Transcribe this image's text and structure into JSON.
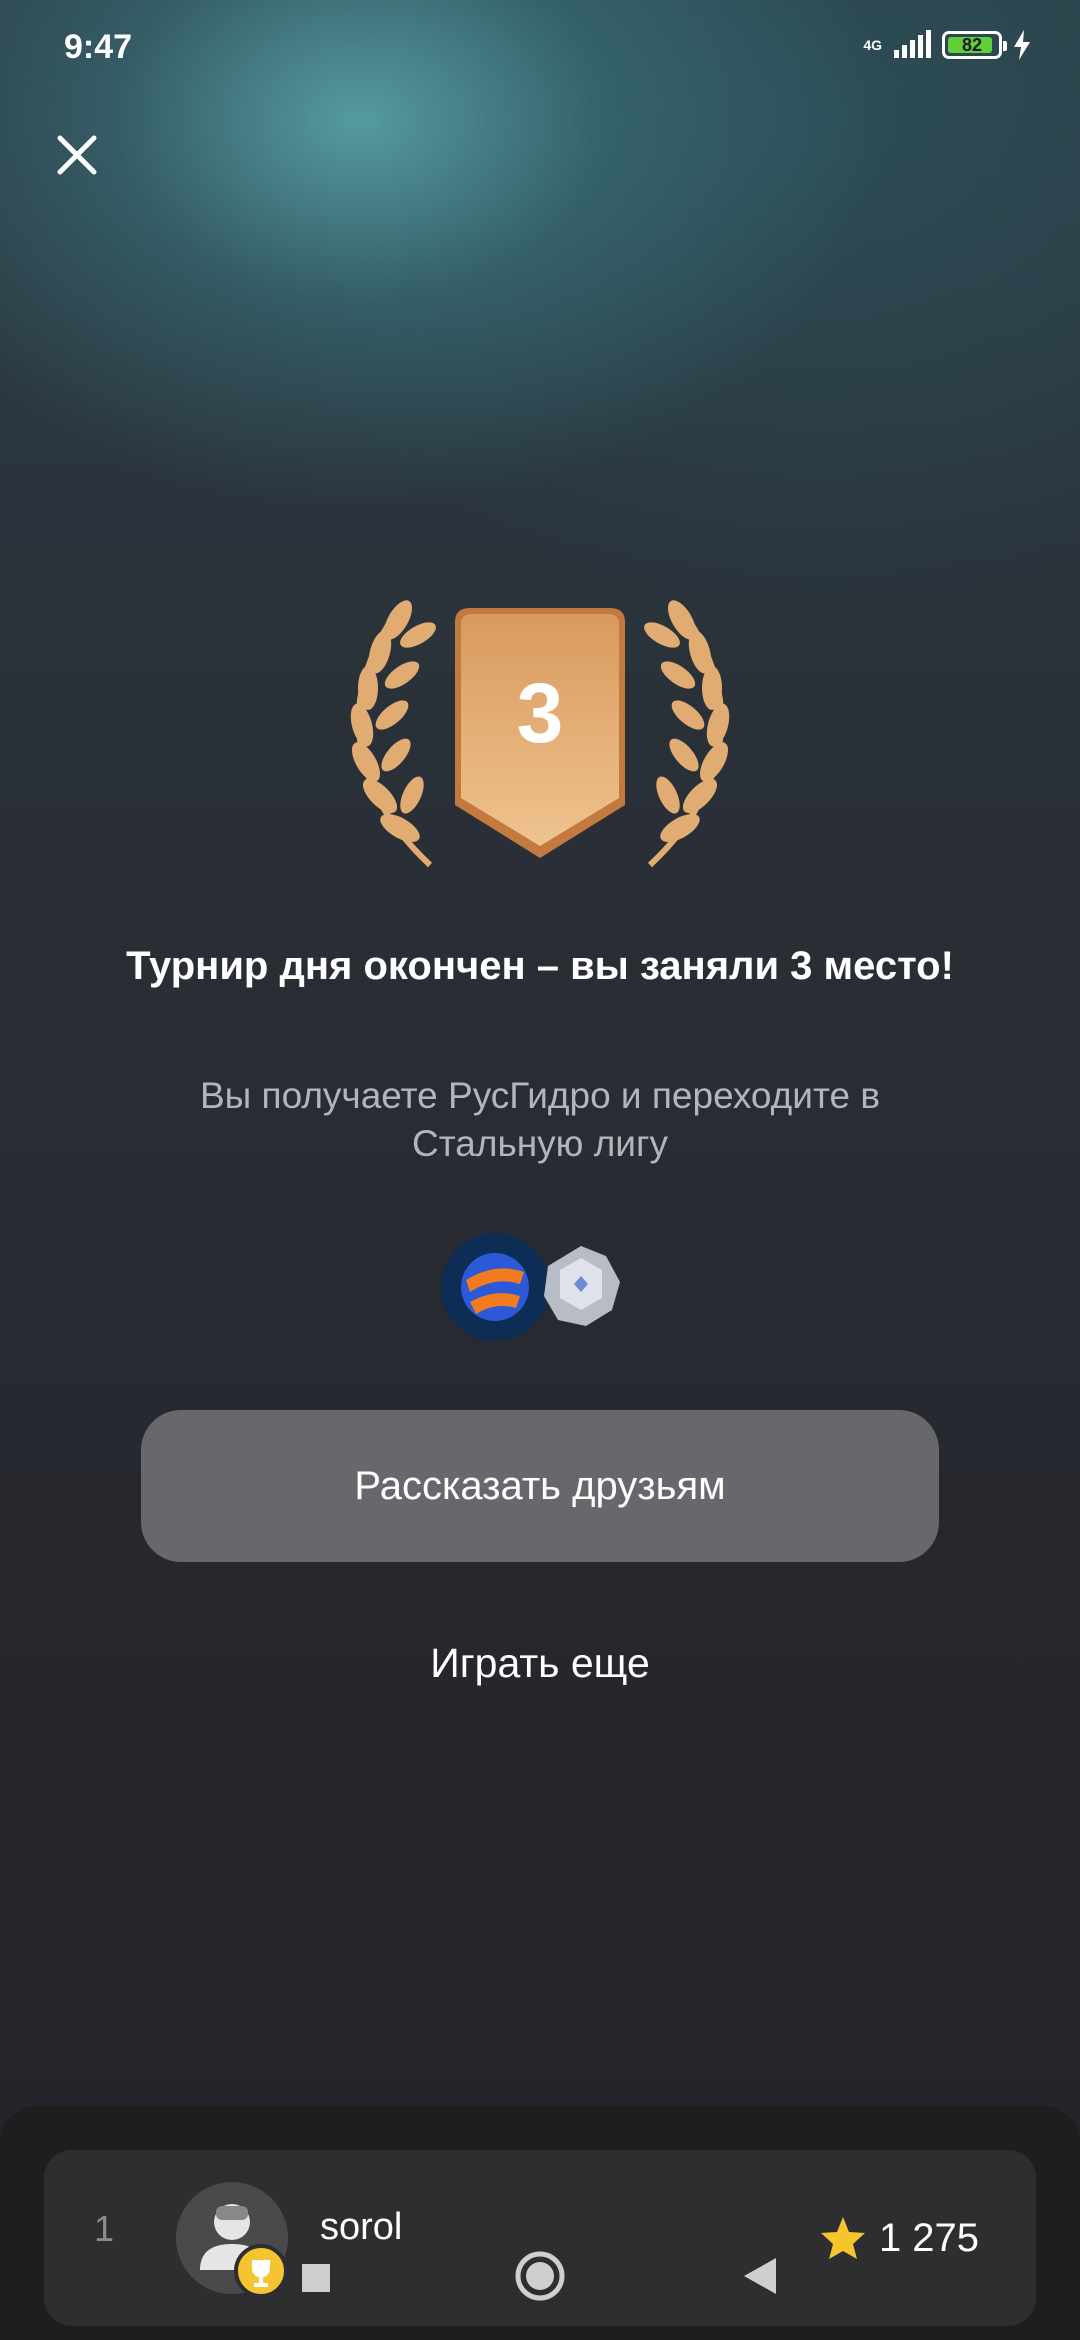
{
  "status_bar": {
    "time": "9:47",
    "network": "4G",
    "battery_level": "82"
  },
  "result": {
    "place": "3",
    "title": "Турнир дня окончен – вы заняли 3 место!",
    "subtitle": "Вы получаете РусГидро и переходите в Стальную лигу"
  },
  "actions": {
    "share_label": "Рассказать друзьям",
    "play_again_label": "Играть еще"
  },
  "leaderboard": {
    "rank": "1",
    "username": "sorol",
    "score": "1 275"
  },
  "colors": {
    "badge": "#d99a5e",
    "laurel": "#e0ac72",
    "button": "#68686c",
    "trophy": "#f4c531",
    "star": "#f7c52b"
  }
}
